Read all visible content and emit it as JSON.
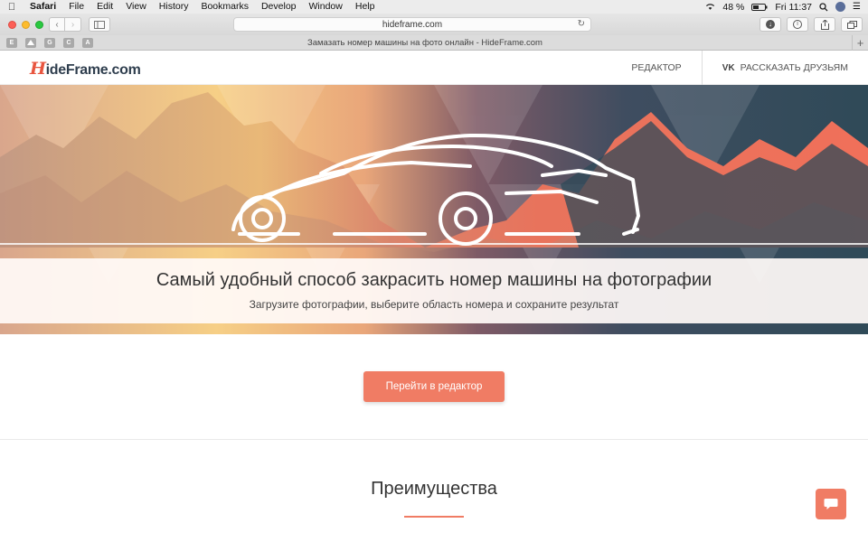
{
  "menubar": {
    "items": [
      "Safari",
      "File",
      "Edit",
      "View",
      "History",
      "Bookmarks",
      "Develop",
      "Window",
      "Help"
    ],
    "battery": "48 %",
    "time": "Fri 11:37"
  },
  "toolbar": {
    "url": "hideframe.com"
  },
  "bookmarks": [
    "E",
    "",
    "G",
    "C",
    "A"
  ],
  "tab": {
    "title": "Замазать номер машины на фото онлайн - HideFrame.com"
  },
  "site": {
    "logo_h": "H",
    "logo_rest": "ideFrame.com",
    "nav_editor": "РЕДАКТОР",
    "nav_share": "РАССКАЗАТЬ ДРУЗЬЯМ",
    "vk_label": "VK"
  },
  "hero": {
    "title": "Самый удобный способ закрасить номер машины на фотографии",
    "subtitle": "Загрузите фотографии, выберите область номера и сохраните результат"
  },
  "cta": {
    "label": "Перейти в редактор"
  },
  "advantages": {
    "title": "Преимущества"
  },
  "colors": {
    "accent": "#f07c64",
    "hero_warm": "#f2c27f",
    "hero_dark": "#2f4a58",
    "hero_red": "#f0705a"
  },
  "icons": [
    "apple-icon",
    "wifi-icon",
    "search-icon",
    "back-icon",
    "forward-icon",
    "sidebar-icon",
    "reload-icon",
    "download-icon",
    "info-icon",
    "share-icon",
    "tabs-icon",
    "vk-icon",
    "chat-icon"
  ]
}
